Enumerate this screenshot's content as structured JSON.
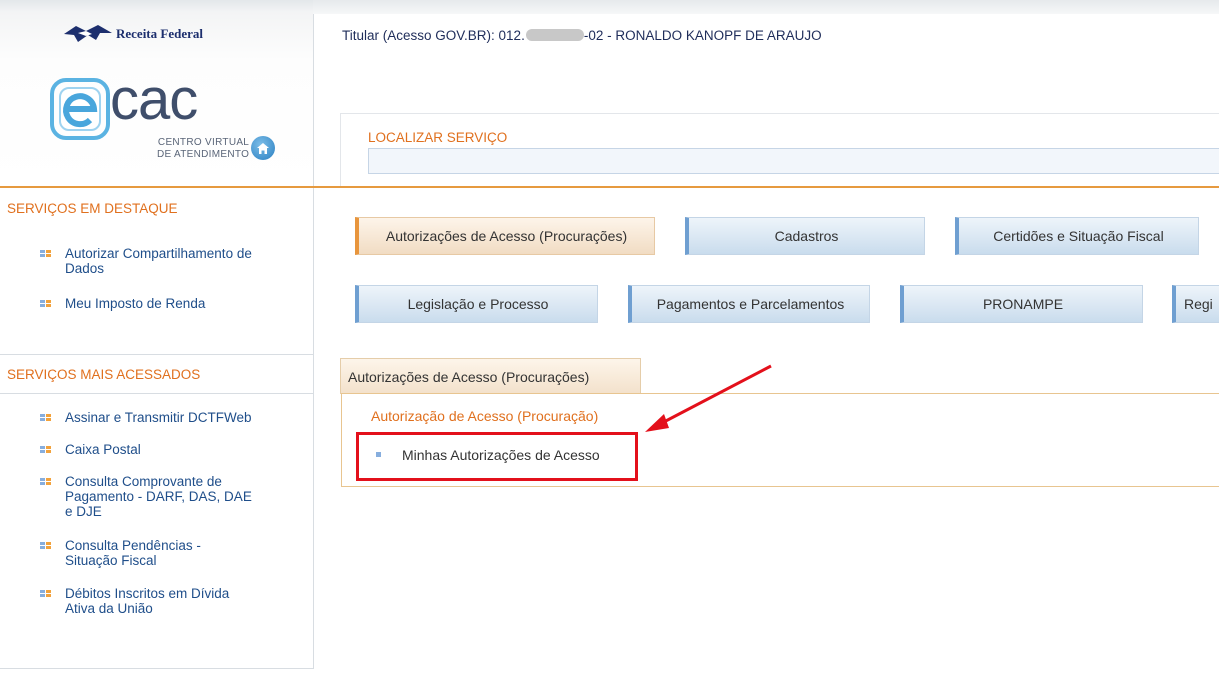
{
  "sidebar": {
    "brand": "Receita Federal",
    "logo_main": "cac",
    "logo_sub_line1": "CENTRO VIRTUAL",
    "logo_sub_line2": "DE ATENDIMENTO",
    "home_icon": "home-icon",
    "destaque": {
      "title": "SERVIÇOS EM DESTAQUE",
      "items": [
        {
          "line1": "Autorizar Compartilhamento de",
          "line2": "Dados"
        },
        {
          "line1": "Meu Imposto de Renda",
          "line2": ""
        }
      ]
    },
    "mais_acessados": {
      "title": "SERVIÇOS MAIS ACESSADOS",
      "items": [
        {
          "line1": "Assinar e Transmitir DCTFWeb",
          "line2": "",
          "line3": ""
        },
        {
          "line1": "Caixa Postal",
          "line2": "",
          "line3": ""
        },
        {
          "line1": "Consulta Comprovante de",
          "line2": "Pagamento - DARF, DAS, DAE",
          "line3": "e DJE"
        },
        {
          "line1": "Consulta Pendências -",
          "line2": "Situação Fiscal",
          "line3": ""
        },
        {
          "line1": "Débitos Inscritos em Dívida",
          "line2": "Ativa da União",
          "line3": ""
        }
      ]
    }
  },
  "header": {
    "titular_prefix": "Titular (Acesso GOV.BR): 012.",
    "titular_suffix": "-02 - RONALDO KANOPF DE ARAUJO"
  },
  "search": {
    "label": "LOCALIZAR SERVIÇO",
    "value": ""
  },
  "services": {
    "row1": [
      {
        "label": "Autorizações de Acesso (Procurações)",
        "active": true
      },
      {
        "label": "Cadastros",
        "active": false
      },
      {
        "label": "Certidões e Situação Fiscal",
        "active": false
      }
    ],
    "row2": [
      {
        "label": "Legislação e Processo",
        "active": false
      },
      {
        "label": "Pagamentos e Parcelamentos",
        "active": false
      },
      {
        "label": "PRONAMPE",
        "active": false
      },
      {
        "label": "Regi",
        "active": false
      }
    ]
  },
  "panel": {
    "tab_label": "Autorizações de Acesso (Procurações)",
    "group_title": "Autorização de Acesso (Procuração)",
    "item": "Minhas Autorizações de Acesso"
  },
  "colors": {
    "accent_orange": "#e0701e",
    "link_blue": "#1f4e8a",
    "highlight_red": "#e3101b"
  }
}
